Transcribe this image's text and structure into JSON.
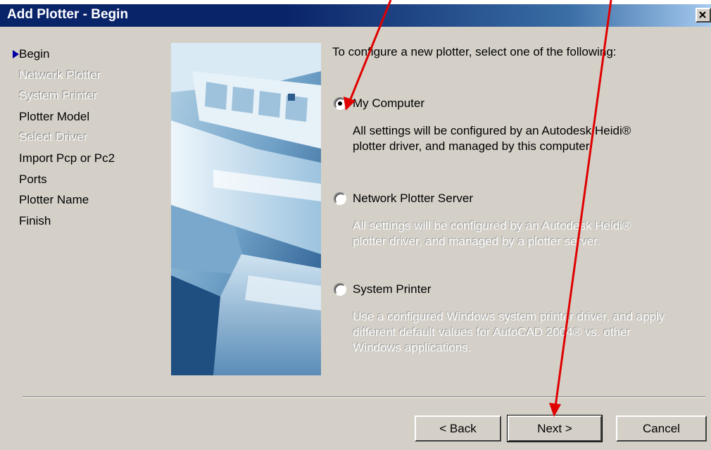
{
  "window": {
    "title": "Add Plotter - Begin",
    "close_icon": "close-icon"
  },
  "steps": [
    {
      "label": "Begin",
      "state": "current"
    },
    {
      "label": "Network Plotter",
      "state": "disabled"
    },
    {
      "label": "System Printer",
      "state": "disabled"
    },
    {
      "label": "Plotter Model",
      "state": "enabled"
    },
    {
      "label": "Select Driver",
      "state": "disabled"
    },
    {
      "label": "Import Pcp or Pc2",
      "state": "enabled"
    },
    {
      "label": "Ports",
      "state": "enabled"
    },
    {
      "label": "Plotter Name",
      "state": "enabled"
    },
    {
      "label": "Finish",
      "state": "enabled"
    }
  ],
  "main": {
    "intro": "To configure a new plotter, select one of the following:",
    "options": [
      {
        "label": "My Computer",
        "selected": true,
        "description_enabled": true,
        "description_lines": [
          "All settings will be configured by an Autodesk Heidi®",
          "plotter driver, and managed by this computer."
        ]
      },
      {
        "label": "Network Plotter Server",
        "selected": false,
        "description_enabled": false,
        "description_lines": [
          "All settings will be configured by an Autodesk Heidi®",
          "plotter driver, and managed by a plotter server."
        ]
      },
      {
        "label": "System Printer",
        "selected": false,
        "description_enabled": false,
        "description_lines": [
          "Use a configured Windows system printer driver, and apply",
          "different default values for AutoCAD 2004® vs. other",
          "Windows applications."
        ]
      }
    ]
  },
  "buttons": {
    "back": "< Back",
    "next": "Next >",
    "cancel": "Cancel"
  },
  "colors": {
    "titlebar": "#0a246a",
    "dialog_face": "#d4d0c8",
    "annotation_arrows": "#e00000"
  }
}
